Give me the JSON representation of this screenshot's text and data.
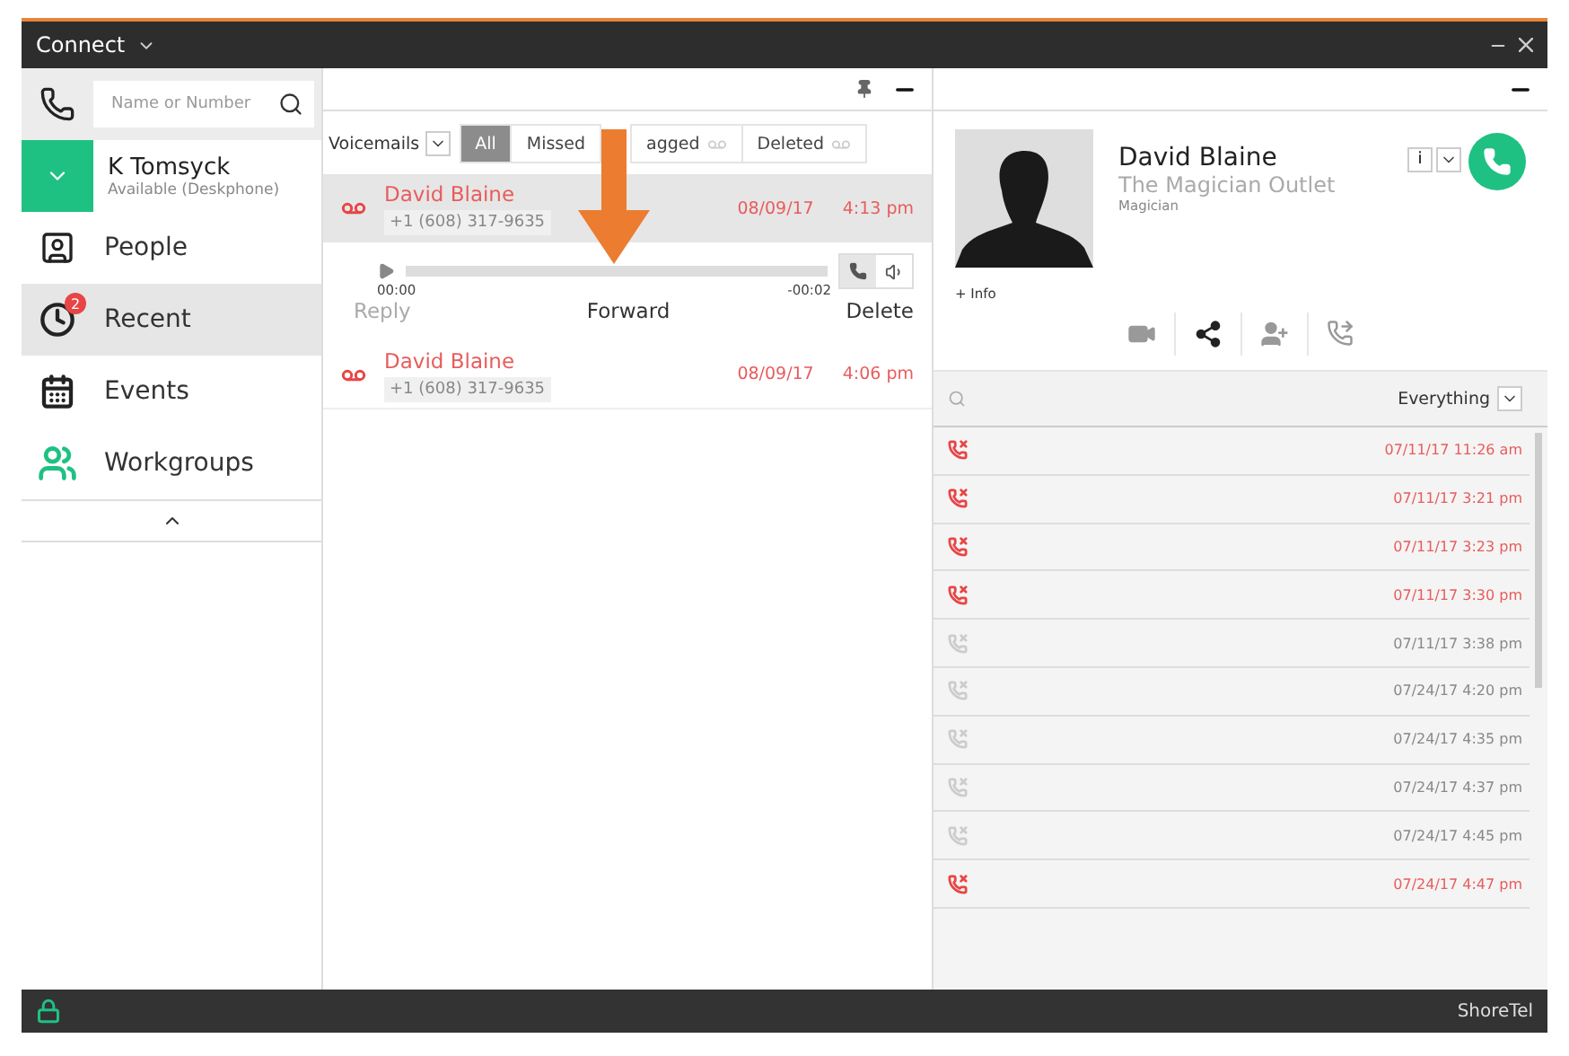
{
  "window": {
    "title": "Connect"
  },
  "sidebar": {
    "search": {
      "placeholder": "Name or Number"
    },
    "user": {
      "name": "K Tomsyck",
      "status": "Available (Deskphone)"
    },
    "items": [
      {
        "kind": "people",
        "label": "People",
        "selected": false
      },
      {
        "kind": "recent",
        "label": "Recent",
        "selected": true,
        "badge": "2"
      },
      {
        "kind": "events",
        "label": "Events",
        "selected": false
      },
      {
        "kind": "workgroups",
        "label": "Workgroups",
        "selected": false
      }
    ]
  },
  "voicemails": {
    "filter": "Voicemails",
    "tabs": [
      {
        "label": "All",
        "selected": true,
        "kind": "plain"
      },
      {
        "label": "Missed",
        "selected": false,
        "kind": "plain"
      },
      {
        "label": "agged",
        "selected": false,
        "kind": "voicemail"
      },
      {
        "label": "Deleted",
        "selected": false,
        "kind": "voicemail"
      }
    ],
    "items": [
      {
        "name": "David Blaine",
        "number": "+1 (608) 317-9635",
        "date": "08/09/17",
        "time": "4:13 pm",
        "selected": true,
        "player": {
          "elapsed": "00:00",
          "remaining": "-00:02",
          "actions": [
            {
              "label": "Reply",
              "disabled": true
            },
            {
              "label": "Forward",
              "disabled": false
            },
            {
              "label": "Delete",
              "disabled": false
            }
          ]
        }
      },
      {
        "name": "David Blaine",
        "number": "+1 (608) 317-9635",
        "date": "08/09/17",
        "time": "4:06 pm",
        "selected": false
      }
    ]
  },
  "annotation": {
    "kind": "arrow"
  },
  "contact": {
    "name": "David Blaine",
    "company": "The Magician Outlet",
    "title": "Magician",
    "info": "+ Info",
    "info_button": "i"
  },
  "history": {
    "filter": "Everything",
    "calls": [
      {
        "time": "07/11/17 11:26 am",
        "missed": true
      },
      {
        "time": "07/11/17 3:21 pm",
        "missed": true
      },
      {
        "time": "07/11/17 3:23 pm",
        "missed": true
      },
      {
        "time": "07/11/17 3:30 pm",
        "missed": true
      },
      {
        "time": "07/11/17 3:38 pm",
        "missed": false
      },
      {
        "time": "07/24/17 4:20 pm",
        "missed": false
      },
      {
        "time": "07/24/17 4:35 pm",
        "missed": false
      },
      {
        "time": "07/24/17 4:37 pm",
        "missed": false
      },
      {
        "time": "07/24/17 4:45 pm",
        "missed": false
      },
      {
        "time": "07/24/17 4:47 pm",
        "missed": true
      }
    ]
  },
  "status_bar": {
    "brand": "ShoreTel"
  }
}
